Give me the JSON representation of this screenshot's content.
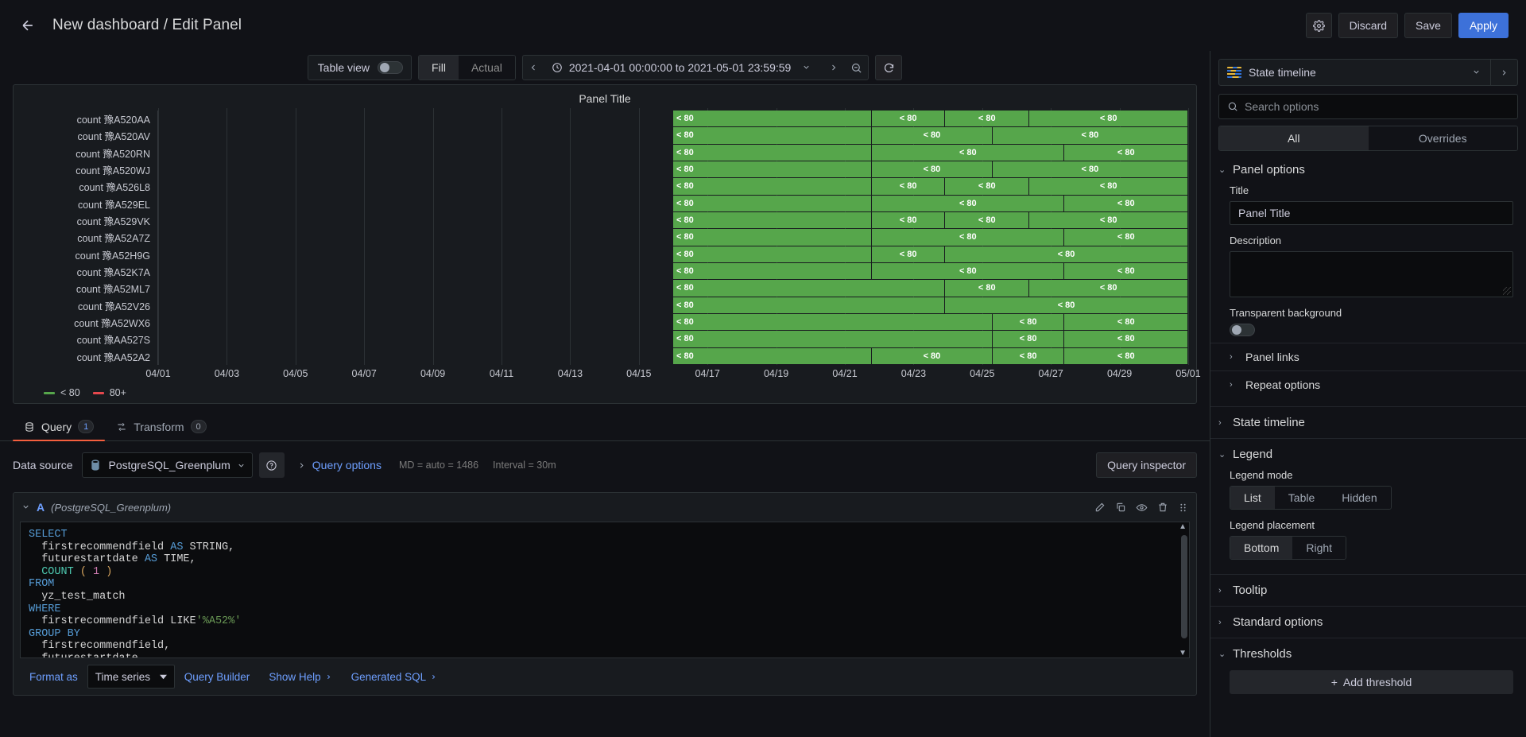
{
  "header": {
    "back_icon": "arrow-left-icon",
    "breadcrumb": "New dashboard / Edit Panel",
    "settings_icon": "gear-icon",
    "discard_label": "Discard",
    "save_label": "Save",
    "apply_label": "Apply"
  },
  "viz_toolbar": {
    "table_view_label": "Table view",
    "table_view_on": false,
    "fill_label": "Fill",
    "actual_label": "Actual",
    "fill_active": true,
    "time_range": "2021-04-01 00:00:00 to 2021-05-01 23:59:59",
    "clock_icon": "clock-icon",
    "prev_icon": "chevron-left-icon",
    "next_icon": "chevron-right-icon",
    "caret_icon": "chevron-down-icon",
    "zoom_out_icon": "zoom-out-icon",
    "refresh_icon": "refresh-icon"
  },
  "panel": {
    "title": "Panel Title"
  },
  "chart_data": {
    "type": "heatmap",
    "title": "Panel Title",
    "xlabel": "",
    "ylabel": "",
    "state_label": "< 80",
    "categories": [
      "count 豫A520AA",
      "count 豫A520AV",
      "count 豫A520RN",
      "count 豫A520WJ",
      "count 豫A526L8",
      "count 豫A529EL",
      "count 豫A529VK",
      "count 豫A52A7Z",
      "count 豫A52H9G",
      "count 豫A52K7A",
      "count 豫A52ML7",
      "count 豫A52V26",
      "count 豫A52WX6",
      "count 豫AA527S",
      "count 豫AA52A2"
    ],
    "x_ticks": [
      "04/01",
      "04/03",
      "04/05",
      "04/07",
      "04/09",
      "04/11",
      "04/13",
      "04/15",
      "04/17",
      "04/19",
      "04/21",
      "04/23",
      "04/25",
      "04/27",
      "04/29",
      "05/01"
    ],
    "x_range": [
      "2021-04-01",
      "2021-05-01"
    ],
    "legend": [
      {
        "label": "< 80",
        "color": "#56a64b"
      },
      {
        "label": "80+",
        "color": "#e5484d"
      }
    ],
    "series": [
      {
        "name": "count 豫A520AA",
        "segments": [
          {
            "start": 50.0,
            "end": 69.3
          },
          {
            "start": 69.3,
            "end": 76.4
          },
          {
            "start": 76.4,
            "end": 84.6
          },
          {
            "start": 84.6,
            "end": 100.0
          }
        ]
      },
      {
        "name": "count 豫A520AV",
        "segments": [
          {
            "start": 50.0,
            "end": 69.3
          },
          {
            "start": 69.3,
            "end": 81.0
          },
          {
            "start": 81.0,
            "end": 100.0
          }
        ]
      },
      {
        "name": "count 豫A520RN",
        "segments": [
          {
            "start": 50.0,
            "end": 69.3
          },
          {
            "start": 69.3,
            "end": 88.0
          },
          {
            "start": 88.0,
            "end": 100.0
          }
        ]
      },
      {
        "name": "count 豫A520WJ",
        "segments": [
          {
            "start": 50.0,
            "end": 69.3
          },
          {
            "start": 69.3,
            "end": 81.0
          },
          {
            "start": 81.0,
            "end": 100.0
          }
        ]
      },
      {
        "name": "count 豫A526L8",
        "segments": [
          {
            "start": 50.0,
            "end": 69.3
          },
          {
            "start": 69.3,
            "end": 76.4
          },
          {
            "start": 76.4,
            "end": 84.6
          },
          {
            "start": 84.6,
            "end": 100.0
          }
        ]
      },
      {
        "name": "count 豫A529EL",
        "segments": [
          {
            "start": 50.0,
            "end": 69.3
          },
          {
            "start": 69.3,
            "end": 88.0
          },
          {
            "start": 88.0,
            "end": 100.0
          }
        ]
      },
      {
        "name": "count 豫A529VK",
        "segments": [
          {
            "start": 50.0,
            "end": 69.3
          },
          {
            "start": 69.3,
            "end": 76.4
          },
          {
            "start": 76.4,
            "end": 84.6
          },
          {
            "start": 84.6,
            "end": 100.0
          }
        ]
      },
      {
        "name": "count 豫A52A7Z",
        "segments": [
          {
            "start": 50.0,
            "end": 69.3
          },
          {
            "start": 69.3,
            "end": 88.0
          },
          {
            "start": 88.0,
            "end": 100.0
          }
        ]
      },
      {
        "name": "count 豫A52H9G",
        "segments": [
          {
            "start": 50.0,
            "end": 69.3
          },
          {
            "start": 69.3,
            "end": 76.4
          },
          {
            "start": 76.4,
            "end": 100.0
          }
        ]
      },
      {
        "name": "count 豫A52K7A",
        "segments": [
          {
            "start": 50.0,
            "end": 69.3
          },
          {
            "start": 69.3,
            "end": 88.0
          },
          {
            "start": 88.0,
            "end": 100.0
          }
        ]
      },
      {
        "name": "count 豫A52ML7",
        "segments": [
          {
            "start": 50.0,
            "end": 76.4
          },
          {
            "start": 76.4,
            "end": 84.6
          },
          {
            "start": 84.6,
            "end": 100.0
          }
        ]
      },
      {
        "name": "count 豫A52V26",
        "segments": [
          {
            "start": 50.0,
            "end": 76.4
          },
          {
            "start": 76.4,
            "end": 100.0
          }
        ]
      },
      {
        "name": "count 豫A52WX6",
        "segments": [
          {
            "start": 50.0,
            "end": 81.0
          },
          {
            "start": 81.0,
            "end": 88.0
          },
          {
            "start": 88.0,
            "end": 100.0
          }
        ]
      },
      {
        "name": "count 豫AA527S",
        "segments": [
          {
            "start": 50.0,
            "end": 81.0
          },
          {
            "start": 81.0,
            "end": 88.0
          },
          {
            "start": 88.0,
            "end": 100.0
          }
        ]
      },
      {
        "name": "count 豫AA52A2",
        "segments": [
          {
            "start": 50.0,
            "end": 69.3
          },
          {
            "start": 69.3,
            "end": 81.0
          },
          {
            "start": 81.0,
            "end": 88.0
          },
          {
            "start": 88.0,
            "end": 100.0
          }
        ]
      }
    ]
  },
  "tabs": [
    {
      "label": "Query",
      "count": "1",
      "icon": "database-icon",
      "active": true
    },
    {
      "label": "Transform",
      "count": "0",
      "icon": "transform-icon",
      "active": false
    }
  ],
  "query": {
    "data_source_label": "Data source",
    "data_source_name": "PostgreSQL_Greenplum",
    "data_source_icon": "postgres-icon",
    "help_icon": "question-circle-icon",
    "query_options_label": "Query options",
    "query_options_meta_md": "MD = auto = 1486",
    "query_options_meta_interval": "Interval = 30m",
    "query_inspector_label": "Query inspector",
    "ref_id": "A",
    "ref_ds": "(PostgreSQL_Greenplum)",
    "row_actions": [
      "pencil-icon",
      "copy-icon",
      "eye-icon",
      "trash-icon",
      "drag-icon"
    ],
    "sql_lines": [
      [
        {
          "t": "SELECT",
          "c": "kw"
        }
      ],
      [
        {
          "t": "  firstrecommendfield ",
          "c": ""
        },
        {
          "t": "AS",
          "c": "kw"
        },
        {
          "t": " STRING,",
          "c": ""
        }
      ],
      [
        {
          "t": "  futurestartdate ",
          "c": ""
        },
        {
          "t": "AS",
          "c": "kw"
        },
        {
          "t": " TIME,",
          "c": ""
        }
      ],
      [
        {
          "t": "  ",
          "c": ""
        },
        {
          "t": "COUNT",
          "c": "fn"
        },
        {
          "t": " (",
          "c": "paren"
        },
        {
          "t": " 1 ",
          "c": "num"
        },
        {
          "t": ")",
          "c": "paren"
        }
      ],
      [
        {
          "t": "FROM",
          "c": "kw"
        }
      ],
      [
        {
          "t": "  yz_test_match",
          "c": ""
        }
      ],
      [
        {
          "t": "WHERE",
          "c": "kw"
        }
      ],
      [
        {
          "t": "  firstrecommendfield LIKE",
          "c": ""
        },
        {
          "t": "'%A52%'",
          "c": "str"
        }
      ],
      [
        {
          "t": "GROUP BY",
          "c": "kw"
        }
      ],
      [
        {
          "t": "  firstrecommendfield,",
          "c": ""
        }
      ],
      [
        {
          "t": "  futurestartdate",
          "c": ""
        }
      ]
    ],
    "format_as_label": "Format as",
    "format_as_value": "Time series",
    "query_builder_label": "Query Builder",
    "show_help_label": "Show Help",
    "generated_sql_label": "Generated SQL"
  },
  "options": {
    "viz_name": "State timeline",
    "viz_icon": "state-timeline-icon",
    "search_placeholder": "Search options",
    "search_value": "",
    "search_icon": "search-icon",
    "tab_all": "All",
    "tab_overrides": "Overrides",
    "panel_options_title": "Panel options",
    "title_label": "Title",
    "title_value": "Panel Title",
    "description_label": "Description",
    "description_value": "",
    "transparent_label": "Transparent background",
    "transparent_on": false,
    "panel_links_label": "Panel links",
    "repeat_options_label": "Repeat options",
    "state_timeline_title": "State timeline",
    "legend_title": "Legend",
    "legend_mode_label": "Legend mode",
    "legend_modes": [
      "List",
      "Table",
      "Hidden"
    ],
    "legend_mode_value": "List",
    "legend_placement_label": "Legend placement",
    "legend_placements": [
      "Bottom",
      "Right"
    ],
    "legend_placement_value": "Bottom",
    "tooltip_title": "Tooltip",
    "standard_options_title": "Standard options",
    "thresholds_title": "Thresholds",
    "add_threshold_label": "Add threshold"
  }
}
